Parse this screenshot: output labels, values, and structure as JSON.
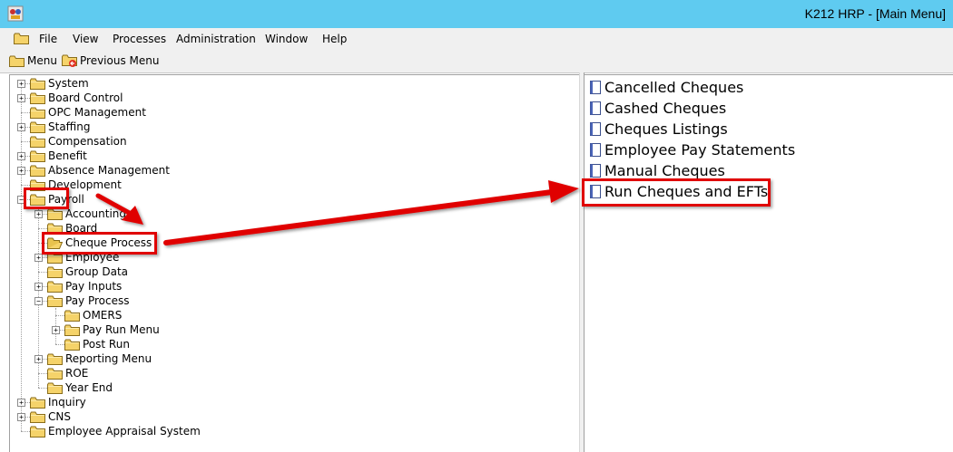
{
  "window": {
    "title": "K212 HRP - [Main Menu]"
  },
  "menubar": {
    "items": [
      "File",
      "View",
      "Processes",
      "Administration",
      "Window",
      "Help"
    ]
  },
  "toolbar": {
    "menu_label": "Menu",
    "previous_label": "Previous Menu"
  },
  "tree": [
    {
      "label": "System",
      "expander": "+"
    },
    {
      "label": "Board Control",
      "expander": "+"
    },
    {
      "label": "OPC Management",
      "expander": ""
    },
    {
      "label": "Staffing",
      "expander": "+"
    },
    {
      "label": "Compensation",
      "expander": ""
    },
    {
      "label": "Benefit",
      "expander": "+"
    },
    {
      "label": "Absence Management",
      "expander": "+"
    },
    {
      "label": "Development",
      "expander": ""
    },
    {
      "label": "Payroll",
      "expander": "-",
      "highlighted": true
    },
    {
      "label": "Accounting",
      "expander": "+"
    },
    {
      "label": "Board",
      "expander": ""
    },
    {
      "label": "Cheque Process",
      "expander": "",
      "selected": true,
      "highlighted": true
    },
    {
      "label": "Employee",
      "expander": "+"
    },
    {
      "label": "Group Data",
      "expander": ""
    },
    {
      "label": "Pay Inputs",
      "expander": "+"
    },
    {
      "label": "Pay Process",
      "expander": "-"
    },
    {
      "label": "OMERS",
      "expander": ""
    },
    {
      "label": "Pay Run Menu",
      "expander": "+"
    },
    {
      "label": "Post Run",
      "expander": ""
    },
    {
      "label": "Reporting Menu",
      "expander": "+"
    },
    {
      "label": "ROE",
      "expander": ""
    },
    {
      "label": "Year End",
      "expander": ""
    },
    {
      "label": "Inquiry",
      "expander": "+"
    },
    {
      "label": "CNS",
      "expander": "+"
    },
    {
      "label": "Employee Appraisal System",
      "expander": ""
    }
  ],
  "right_items": [
    {
      "label": "Cancelled Cheques"
    },
    {
      "label": "Cashed Cheques"
    },
    {
      "label": "Cheques Listings"
    },
    {
      "label": "Employee Pay Statements"
    },
    {
      "label": "Manual Cheques"
    },
    {
      "label": "Run Cheques and EFTs",
      "highlighted": true
    }
  ],
  "colors": {
    "titlebar": "#5fcbf0",
    "annotation": "#e00000",
    "folder": "#f5d36a"
  }
}
